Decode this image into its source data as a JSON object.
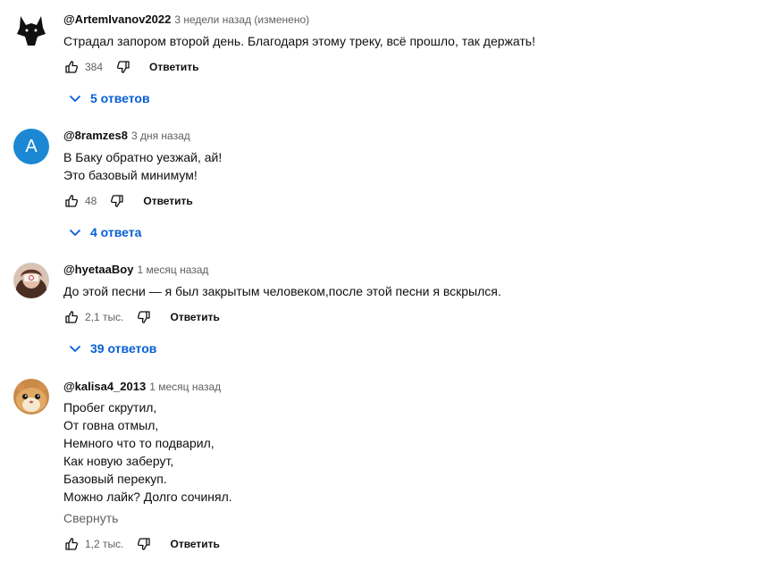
{
  "comments": [
    {
      "author": "@ArtemIvanov2022",
      "time": "3 недели назад (изменено)",
      "lines": [
        "Страдал запором второй день. Благодаря этому треку, всё прошло, так держать!"
      ],
      "likes": "384",
      "reply_label": "Ответить",
      "replies_label": "5 ответов",
      "avatar_icon": "wolf-icon"
    },
    {
      "author": "@8ramzes8",
      "time": "3 дня назад",
      "lines": [
        "В Баку обратно уезжай, ай!",
        "Это базовый минимум!"
      ],
      "likes": "48",
      "reply_label": "Ответить",
      "replies_label": "4 ответа",
      "avatar_letter": "A",
      "avatar_color": "#1c88d4"
    },
    {
      "author": "@hyetaaBoy",
      "time": "1 месяц назад",
      "lines": [
        "До этой песни — я был закрытым человеком,после этой песни я вскрылся."
      ],
      "likes": "2,1 тыс.",
      "reply_label": "Ответить",
      "replies_label": "39 ответов",
      "avatar_icon": "photo-avatar"
    },
    {
      "author": "@kalisa4_2013",
      "time": "1 месяц назад",
      "lines": [
        "Пробег скрутил,",
        "От говна отмыл,",
        "Немного что то подварил,",
        "Как новую заберут,",
        "Базовый перекуп.",
        "Можно лайк? Долго сочинял."
      ],
      "collapse_label": "Свернуть",
      "likes": "1,2 тыс.",
      "reply_label": "Ответить",
      "avatar_icon": "hamster-photo"
    }
  ],
  "colors": {
    "link_blue": "#065fd4",
    "secondary_text": "#606060",
    "primary_text": "#0f0f0f"
  }
}
